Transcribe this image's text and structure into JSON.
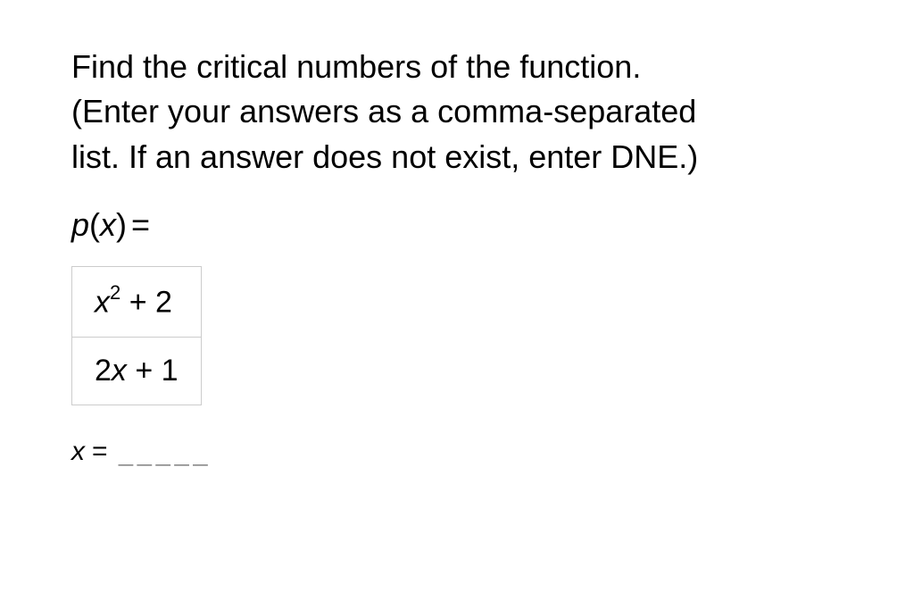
{
  "problem": {
    "line1": "Find the critical numbers of the function.",
    "line2": "(Enter your answers as a comma-separated",
    "line3": "list. If an answer does not exist, enter DNE.)"
  },
  "function": {
    "name": "p",
    "variable": "x",
    "equals": "="
  },
  "fraction": {
    "numerator_x": "x",
    "numerator_exp": "2",
    "numerator_rest": " + 2",
    "denominator_coef": "2",
    "denominator_x": "x",
    "denominator_rest": " + 1"
  },
  "answer": {
    "variable": "x",
    "equals": "=",
    "blank": "_____"
  }
}
